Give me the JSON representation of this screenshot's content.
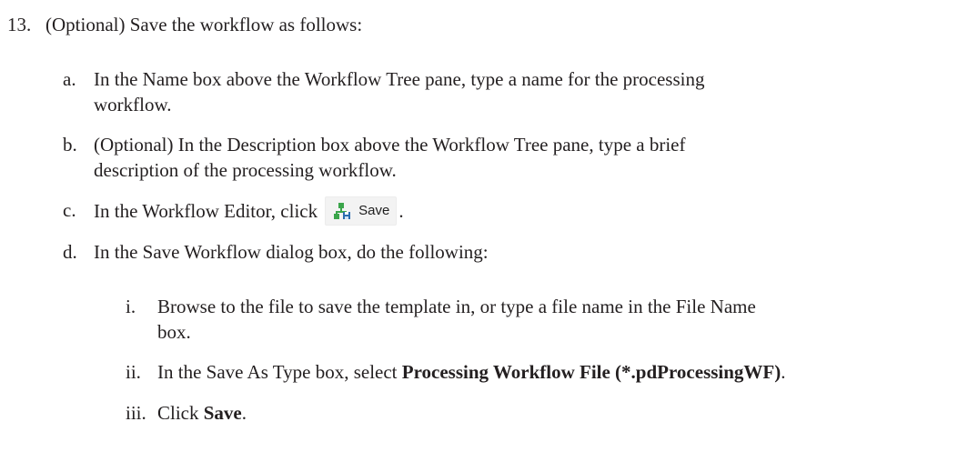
{
  "step": {
    "number": "13.",
    "text": "(Optional) Save the workflow as follows:"
  },
  "substeps": {
    "a": {
      "letter": "a.",
      "line1": "In the Name box above the Workflow Tree pane, type a name for the processing",
      "line2": "workflow."
    },
    "b": {
      "letter": "b.",
      "line1": "(Optional) In the Description box above the Workflow Tree pane, type a brief",
      "line2": "description of the processing workflow."
    },
    "c": {
      "letter": "c.",
      "text_before": "In the Workflow Editor, click",
      "button_label": "Save",
      "button_icon": "save-workflow-icon",
      "text_after": "."
    },
    "d": {
      "letter": "d.",
      "text": "In the Save Workflow dialog box, do the following:",
      "items": {
        "i": {
          "roman": "i.",
          "line1": "Browse to the file to save the template in, or type a file name in the File Name",
          "line2": "box."
        },
        "ii": {
          "roman": "ii.",
          "text_before": "In the Save As Type box, select ",
          "bold": "Processing Workflow File (*.pdProcessingWF)",
          "text_after": "."
        },
        "iii": {
          "roman": "iii.",
          "text_before": "Click ",
          "bold": "Save",
          "text_after": "."
        }
      }
    }
  },
  "colors": {
    "text": "#231f20",
    "button_bg": "#f3f3f3",
    "icon_green": "#3aa54a",
    "icon_blue": "#2b6cb0"
  }
}
